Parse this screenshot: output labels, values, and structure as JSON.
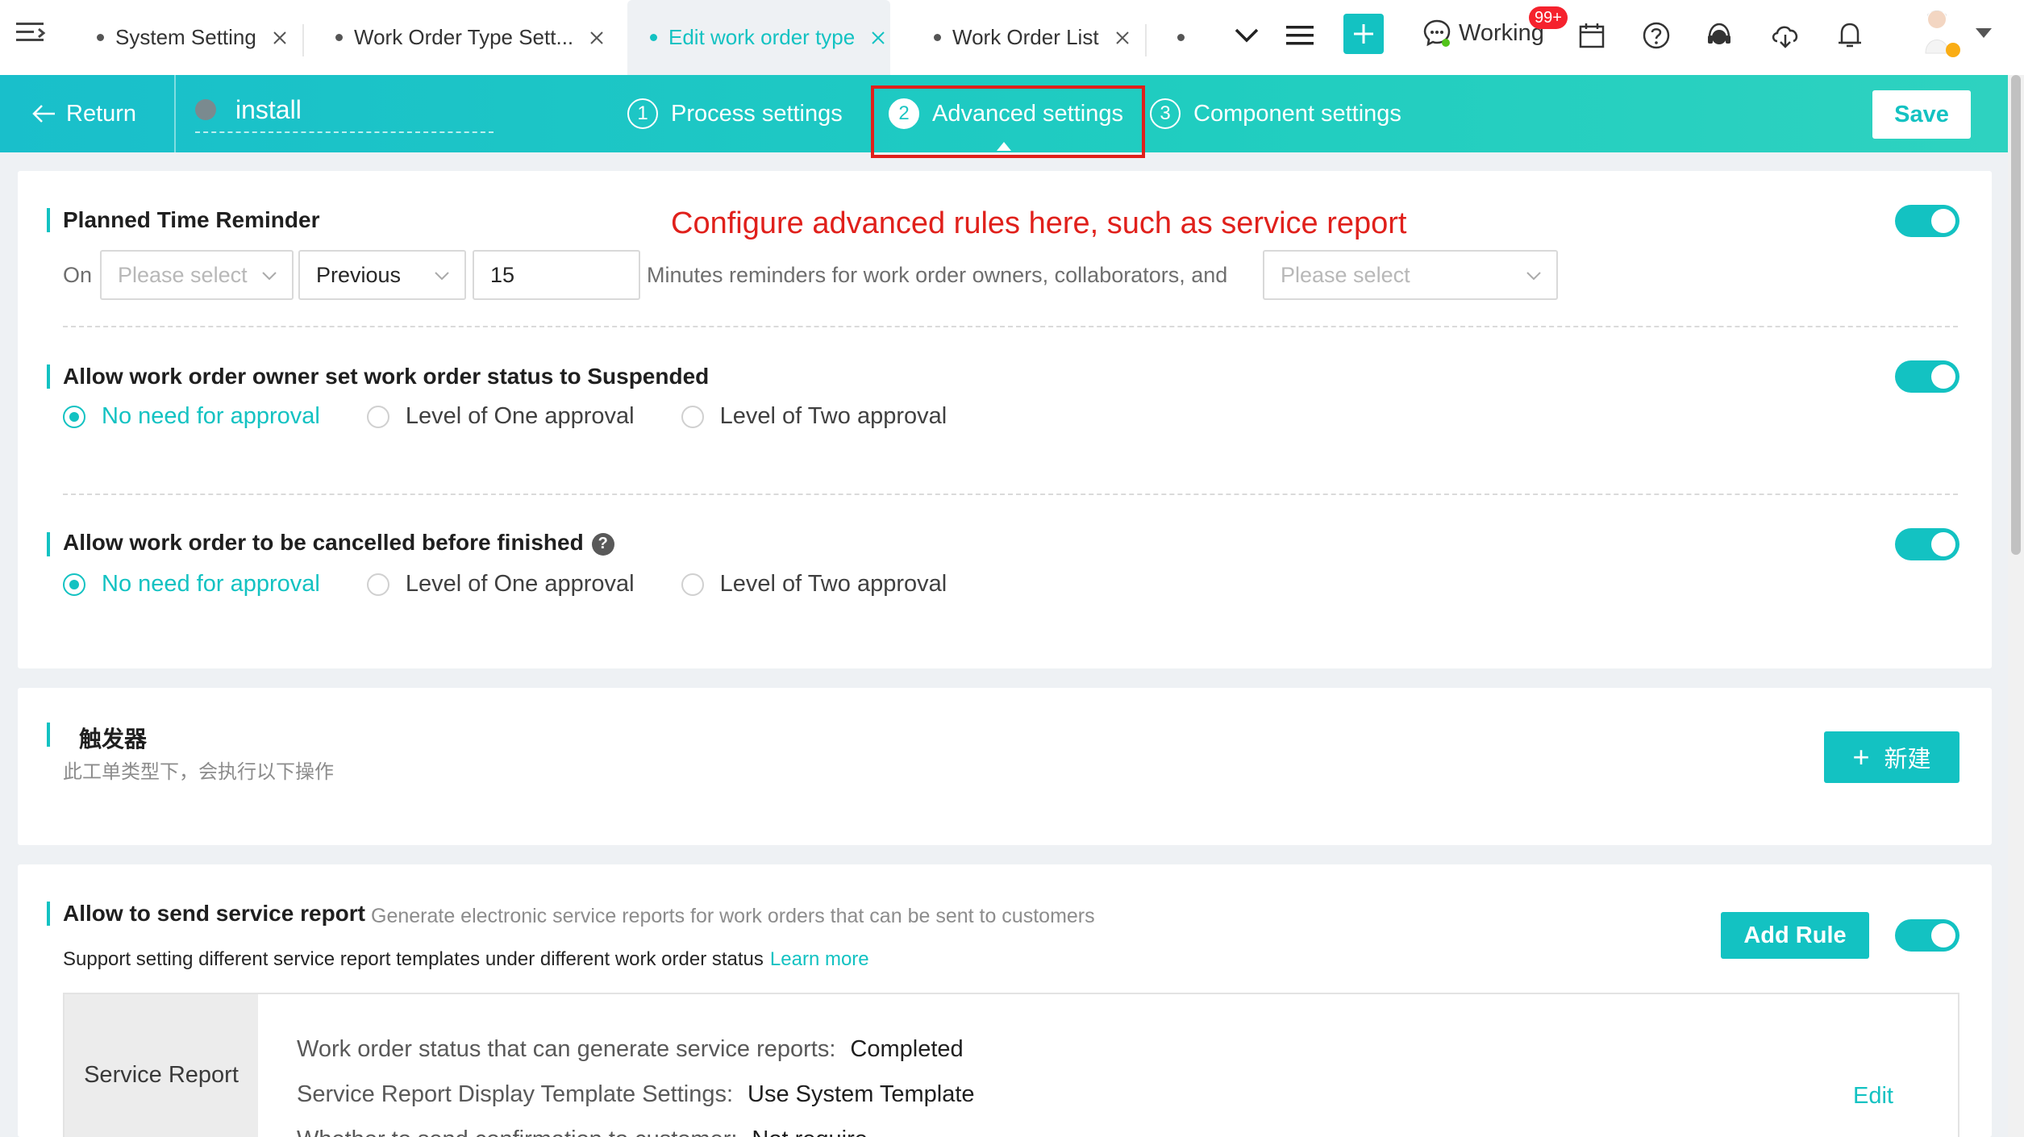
{
  "tabs": [
    {
      "label": "System Setting"
    },
    {
      "label": "Work Order Type Sett..."
    },
    {
      "label": "Edit work order type"
    },
    {
      "label": "Work Order List"
    }
  ],
  "topbar": {
    "working_label": "Working",
    "notification_badge": "99+"
  },
  "header": {
    "return_label": "Return",
    "work_order_name": "install",
    "steps": [
      {
        "number": "1",
        "label": "Process settings"
      },
      {
        "number": "2",
        "label": "Advanced settings"
      },
      {
        "number": "3",
        "label": "Component settings"
      }
    ],
    "active_step": "Advanced settings",
    "save_label": "Save"
  },
  "annotation": "Configure advanced rules here, such as service report",
  "reminder": {
    "title": "Planned Time Reminder",
    "on_label": "On",
    "time_field_placeholder": "Please select",
    "direction_value": "Previous",
    "minutes_value": "15",
    "middle_text": "Minutes reminders for work order owners, collaborators, and",
    "recipients_placeholder": "Please select",
    "enabled": true
  },
  "suspend": {
    "title": "Allow work order owner set work order status to Suspended",
    "enabled": true,
    "options": [
      "No need for approval",
      "Level of One approval",
      "Level of Two approval"
    ],
    "selected": "No need for approval"
  },
  "cancel": {
    "title": "Allow work order to be cancelled before finished",
    "help_glyph": "?",
    "enabled": true,
    "options": [
      "No need for approval",
      "Level of One approval",
      "Level of Two approval"
    ],
    "selected": "No need for approval"
  },
  "trigger": {
    "title": "触发器",
    "subtitle": "此工单类型下，会执行以下操作",
    "new_plus": "+",
    "new_label": "新建"
  },
  "service_report": {
    "title": "Allow to send service report",
    "description": "Generate electronic service reports for work orders that can be sent to customers",
    "support_text": "Support setting different service report templates under different work order status",
    "learn_more": "Learn more",
    "add_rule_label": "Add Rule",
    "enabled": true,
    "rule": {
      "side_label": "Service Report",
      "status_label": "Work order status that can generate service reports:",
      "status_value": "Completed",
      "template_label": "Service Report Display Template Settings:",
      "template_value": "Use System Template",
      "confirm_label": "Whether to send confirmation to customer:",
      "confirm_value": "Not require",
      "edit_label": "Edit"
    }
  },
  "colors": {
    "accent": "#13c2c2",
    "annotation": "#e0201b",
    "badge": "#f5222d"
  },
  "icons": [
    "menu-toggle-icon",
    "close-icon",
    "chevron-down-icon",
    "hamburger-icon",
    "plus-icon",
    "chat-icon",
    "calendar-icon",
    "help-circle-icon",
    "headset-icon",
    "cloud-download-icon",
    "bell-icon",
    "arrow-left-icon"
  ]
}
